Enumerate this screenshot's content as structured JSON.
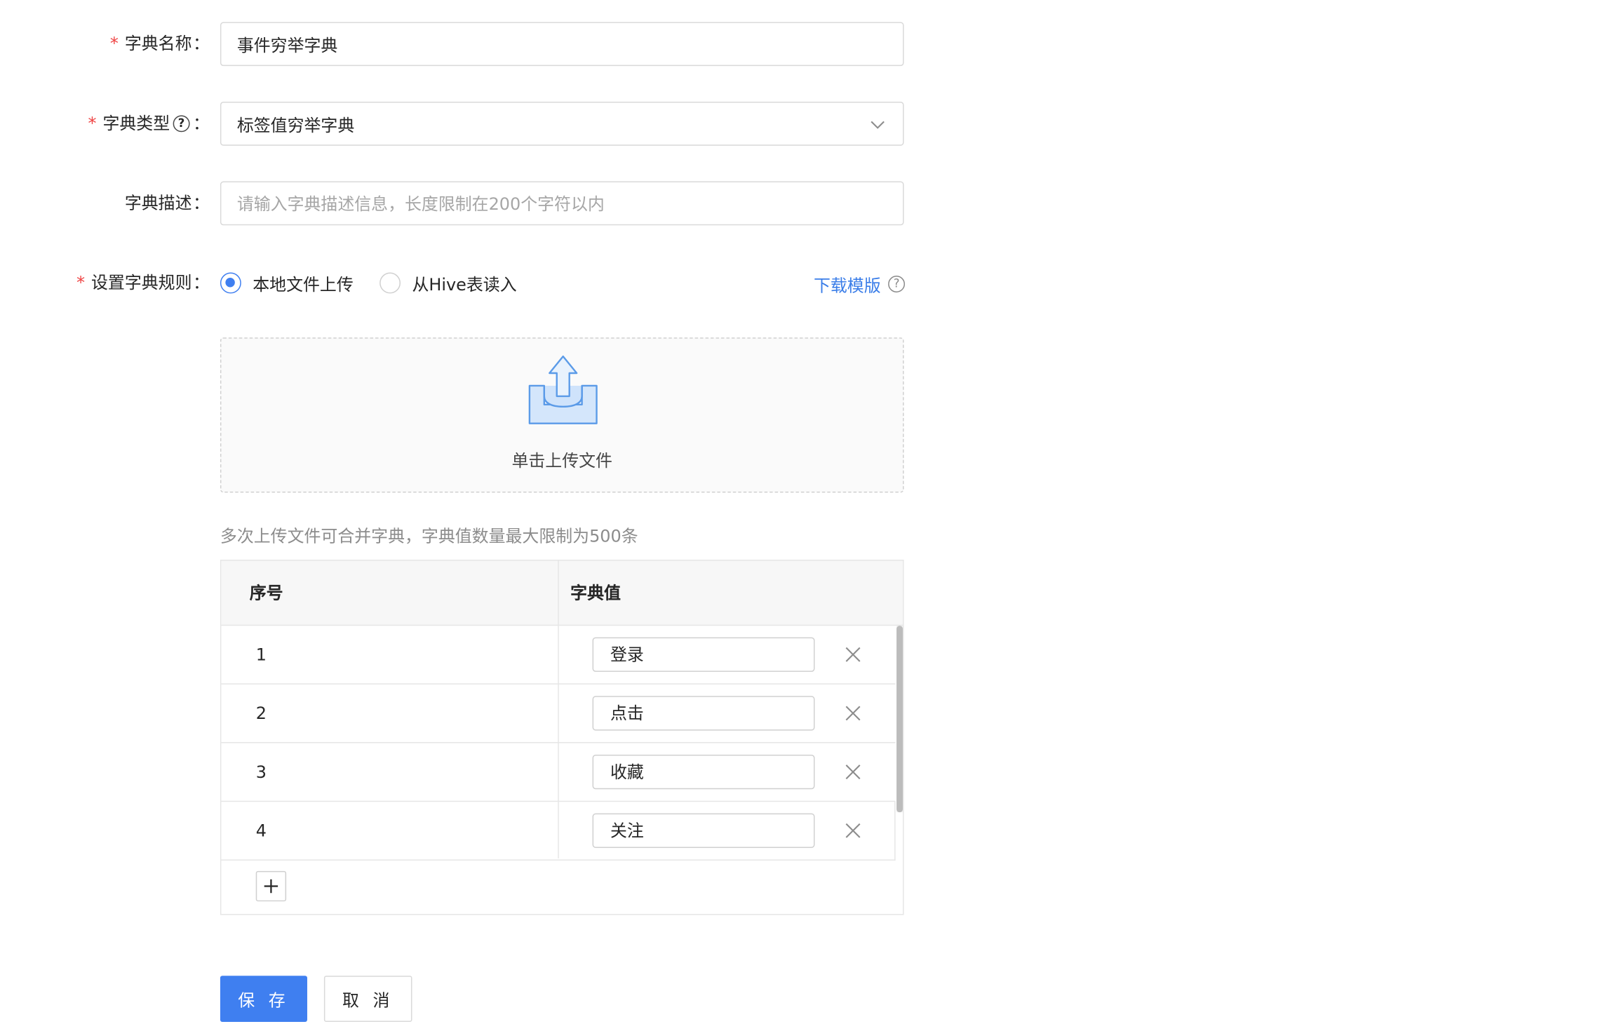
{
  "form": {
    "name": {
      "required_mark": "*",
      "label": "字典名称",
      "colon": "：",
      "value": "事件穷举字典"
    },
    "type": {
      "required_mark": "*",
      "label": "字典类型",
      "help_icon": "question-circle-icon",
      "colon": "：",
      "value": "标签值穷举字典",
      "dropdown_icon": "chevron-down-icon"
    },
    "description": {
      "label": "字典描述",
      "colon": "：",
      "value": "",
      "placeholder": "请输入字典描述信息，长度限制在200个字符以内"
    },
    "rules": {
      "required_mark": "*",
      "label": "设置字典规则",
      "colon": "：",
      "options": [
        {
          "label": "本地文件上传",
          "selected": true
        },
        {
          "label": "从Hive表读入",
          "selected": false
        }
      ],
      "download_link": "下载模版",
      "download_help_icon": "question-circle-icon"
    }
  },
  "upload": {
    "icon": "upload-inbox-icon",
    "text": "单击上传文件",
    "hint": "多次上传文件可合并字典，字典值数量最大限制为500条"
  },
  "table": {
    "columns": [
      "序号",
      "字典值"
    ],
    "rows": [
      {
        "index": "1",
        "value": "登录"
      },
      {
        "index": "2",
        "value": "点击"
      },
      {
        "index": "3",
        "value": "收藏"
      },
      {
        "index": "4",
        "value": "关注"
      }
    ],
    "delete_icon": "close-icon",
    "add_icon": "plus-icon"
  },
  "actions": {
    "save": "保 存",
    "cancel": "取 消"
  },
  "colors": {
    "primary": "#3f7ff0",
    "required": "#ef4444",
    "link": "#3a7de8"
  }
}
